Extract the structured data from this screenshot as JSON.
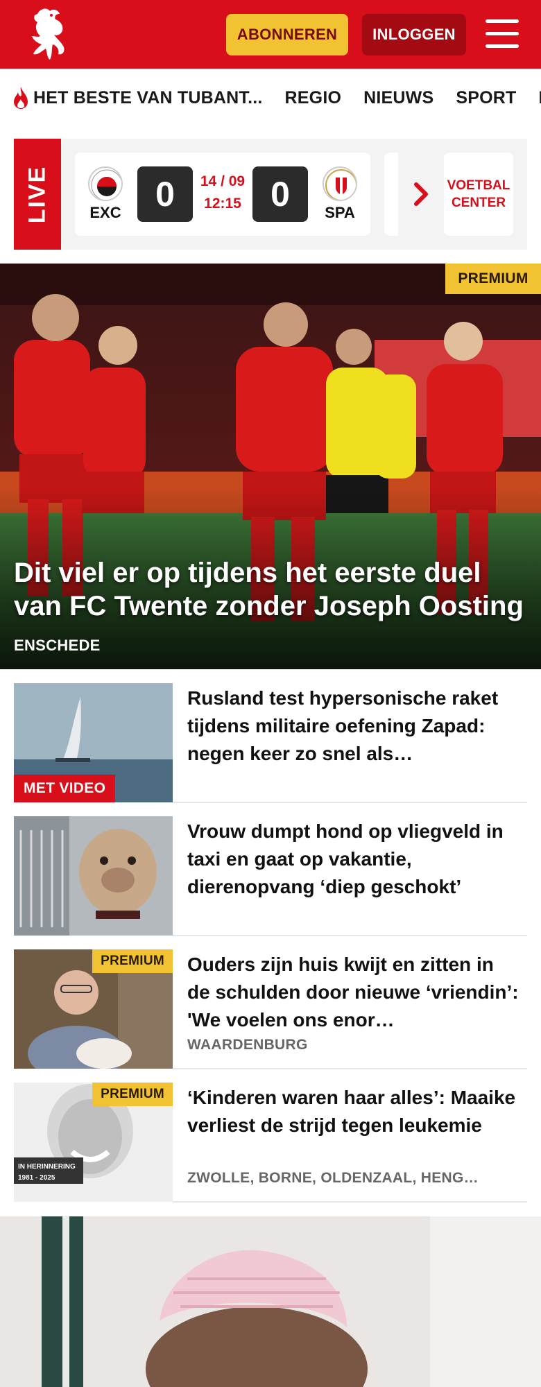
{
  "header": {
    "brand_color": "#d80f1a",
    "subscribe_label": "ABONNEREN",
    "login_label": "INLOGGEN",
    "logo_icon": "tubantia-horse-logo",
    "menu_icon": "hamburger-menu-icon"
  },
  "nav": {
    "items": [
      {
        "label": "HET BESTE VAN TUBANT..."
      },
      {
        "label": "REGIO"
      },
      {
        "label": "NIEUWS"
      },
      {
        "label": "SPORT"
      },
      {
        "label": "K"
      }
    ]
  },
  "live": {
    "tag": "LIVE",
    "match": {
      "home_abbr": "EXC",
      "away_abbr": "SPA",
      "home_score": "0",
      "away_score": "0",
      "date": "14 / 09",
      "time": "12:15"
    },
    "voetbal_center_line1": "VOETBAL",
    "voetbal_center_line2": "CENTER"
  },
  "hero": {
    "premium_label": "PREMIUM",
    "title": "Dit viel er op tijdens het eerste duel van FC Twente zonder Joseph Oosting",
    "location": "ENSCHEDE"
  },
  "articles": [
    {
      "title": "Rusland test hypersonische raket tijdens militaire oefening Zapad: negen keer zo snel als…",
      "badge": "MET VIDEO",
      "location": ""
    },
    {
      "title": "Vrouw dumpt hond op vliegveld in taxi en gaat op vakantie, dierenopvang ‘diep geschokt’",
      "badge": "",
      "location": ""
    },
    {
      "title": "Ouders zijn huis kwijt en zitten in de schulden door nieuwe ‘vriendin’: 'We voelen ons enor…",
      "badge": "PREMIUM",
      "location": "WAARDENBURG"
    },
    {
      "title": "‘Kinderen waren haar alles’: Maaike verliest de strijd tegen leukemie",
      "badge": "PREMIUM",
      "location": "ZWOLLE, BORNE, OLDENZAAL, HENG…",
      "image_caption_line1": "IN HERINNERING",
      "image_caption_line2": "1981 - 2025"
    }
  ]
}
